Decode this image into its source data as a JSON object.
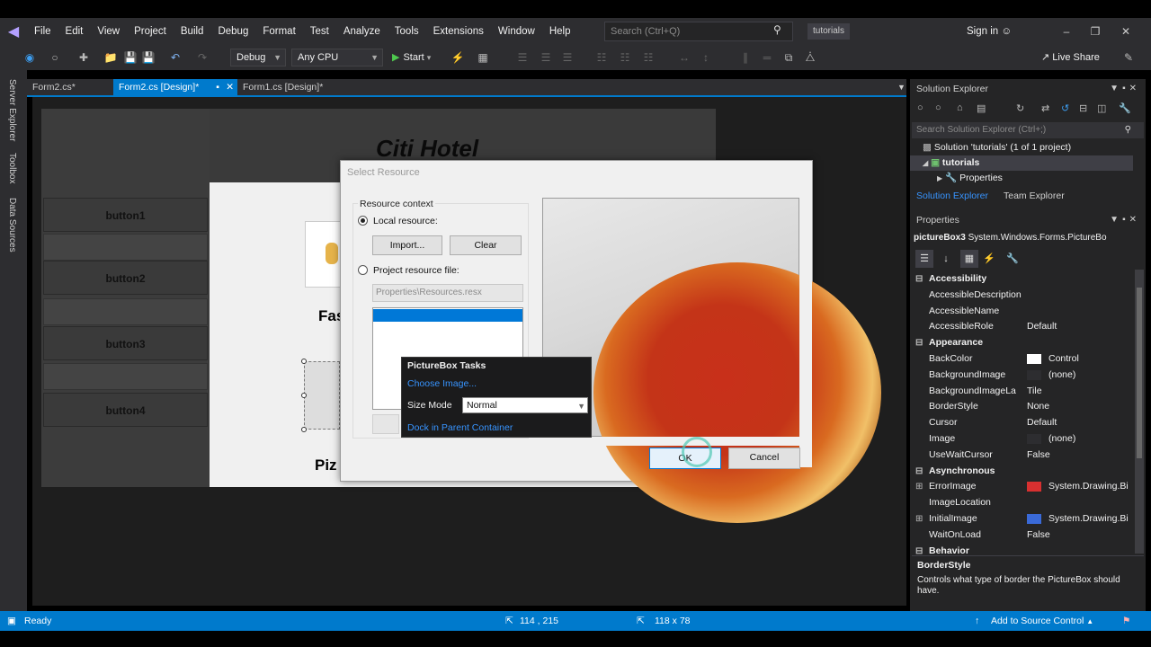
{
  "menu": [
    "File",
    "Edit",
    "View",
    "Project",
    "Build",
    "Debug",
    "Format",
    "Test",
    "Analyze",
    "Tools",
    "Extensions",
    "Window",
    "Help"
  ],
  "search": {
    "placeholder": "Search (Ctrl+Q)"
  },
  "solution_name": "tutorials",
  "signin": "Sign in",
  "toolbar": {
    "config": "Debug",
    "platform": "Any CPU",
    "start": "Start",
    "live_share": "Live Share"
  },
  "left_tabs": [
    "Server Explorer",
    "Toolbox",
    "Data Sources"
  ],
  "doc_tabs": [
    {
      "label": "Form2.cs*",
      "active": false
    },
    {
      "label": "Form2.cs [Design]*",
      "active": true
    },
    {
      "label": "Form1.cs [Design]*",
      "active": false
    }
  ],
  "form": {
    "title": "Citi Hotel",
    "buttons": [
      "button1",
      "button2",
      "button3",
      "button4"
    ],
    "label_fast": "Fas",
    "label_pizza": "Piz"
  },
  "dialog": {
    "title": "Select Resource",
    "group_label": "Resource context",
    "local_resource": "Local resource:",
    "import": "Import...",
    "clear": "Clear",
    "project_resource": "Project resource file:",
    "resource_file": "Properties\\Resources.resx",
    "ok": "OK",
    "cancel": "Cancel"
  },
  "tasks": {
    "title": "PictureBox Tasks",
    "choose_image": "Choose Image...",
    "size_mode_label": "Size Mode",
    "size_mode_value": "Normal",
    "dock": "Dock in Parent Container"
  },
  "solution_explorer": {
    "title": "Solution Explorer",
    "search_placeholder": "Search Solution Explorer (Ctrl+;)",
    "tree": [
      "Solution 'tutorials' (1 of 1 project)",
      "tutorials",
      "Properties"
    ],
    "tabs": [
      "Solution Explorer",
      "Team Explorer"
    ]
  },
  "properties": {
    "title": "Properties",
    "object_name": "pictureBox3",
    "object_type": "System.Windows.Forms.PictureBo",
    "rows": [
      {
        "cat": true,
        "name": "Accessibility"
      },
      {
        "name": "AccessibleDescription",
        "value": ""
      },
      {
        "name": "AccessibleName",
        "value": ""
      },
      {
        "name": "AccessibleRole",
        "value": "Default"
      },
      {
        "cat": true,
        "name": "Appearance"
      },
      {
        "name": "BackColor",
        "value": "Control",
        "swatch": "#ffffff"
      },
      {
        "name": "BackgroundImage",
        "value": "(none)",
        "swatch": "#2d2d30"
      },
      {
        "name": "BackgroundImageLa",
        "value": "Tile"
      },
      {
        "name": "BorderStyle",
        "value": "None"
      },
      {
        "name": "Cursor",
        "value": "Default"
      },
      {
        "name": "Image",
        "value": "(none)",
        "swatch": "#2d2d30"
      },
      {
        "name": "UseWaitCursor",
        "value": "False"
      },
      {
        "cat": true,
        "name": "Asynchronous"
      },
      {
        "name": "ErrorImage",
        "value": "System.Drawing.Bi",
        "swatch": "#d83030",
        "exp": true
      },
      {
        "name": "ImageLocation",
        "value": ""
      },
      {
        "name": "InitialImage",
        "value": "System.Drawing.Bi",
        "swatch": "#3a6ad8",
        "exp": true
      },
      {
        "name": "WaitOnLoad",
        "value": "False"
      },
      {
        "cat": true,
        "name": "Behavior"
      }
    ],
    "desc_title": "BorderStyle",
    "desc_text": "Controls what type of border the PictureBox should have."
  },
  "status": {
    "ready": "Ready",
    "position": "114 , 215",
    "size": "118 x 78",
    "source_control": "Add to Source Control"
  },
  "colors": {
    "accent": "#007acc",
    "link": "#3794ff"
  }
}
